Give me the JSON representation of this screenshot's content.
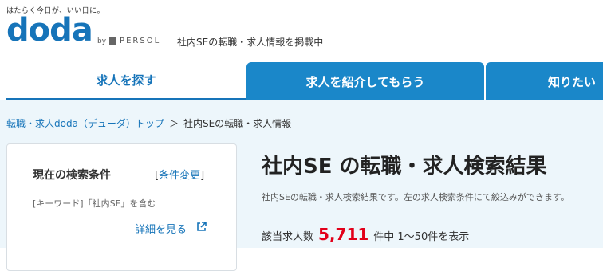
{
  "header": {
    "tagline": "はたらく今日が、いい日に。",
    "logo": "doda",
    "by": "by",
    "brand": "PERSOL",
    "description": "社内SEの転職・求人情報を掲載中"
  },
  "nav": {
    "tabs": [
      {
        "label": "求人を探す"
      },
      {
        "label": "求人を紹介してもらう"
      },
      {
        "label": "知りたい"
      }
    ]
  },
  "breadcrumb": {
    "items": [
      "転職・求人doda（デューダ）トップ",
      "＞",
      "社内SEの転職・求人情報"
    ]
  },
  "search_panel": {
    "title": "現在の検索条件",
    "change_open": "[",
    "change_label": "条件変更",
    "change_close": "]",
    "condition": "[キーワード]「社内SE」を含む",
    "detail_link": "詳細を見る"
  },
  "results": {
    "title": "社内SE の転職・求人検索結果",
    "description": "社内SEの転職・求人検索結果です。左の求人検索条件にて絞込みができます。",
    "count_label": "該当求人数",
    "count": "5,711",
    "range": "件中 1〜50件を表示"
  },
  "colors": {
    "brand": "#1674b9",
    "tab_active_bg": "#1a87c9",
    "count": "#e2001a",
    "content_bg": "#edf6fb"
  }
}
